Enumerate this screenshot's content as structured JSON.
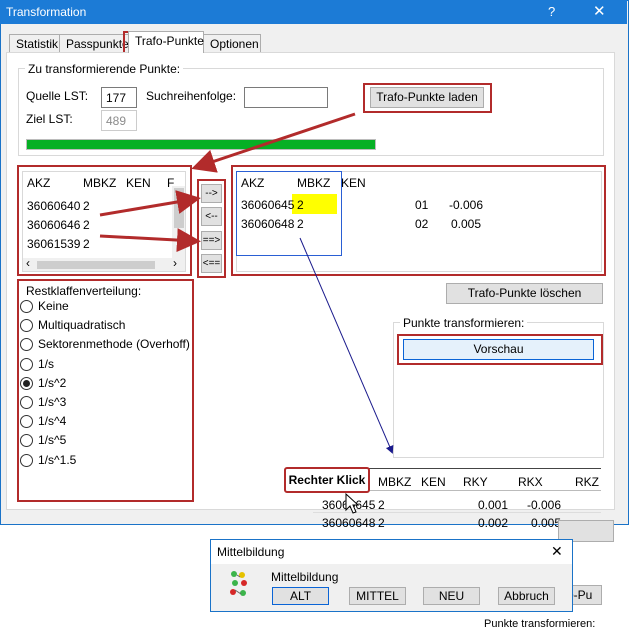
{
  "window": {
    "title": "Transformation",
    "help": "?",
    "close": "✕"
  },
  "tabs": [
    "Statistik",
    "Passpunkte",
    "Trafo-Punkte",
    "Optionen"
  ],
  "source_group": {
    "label": "Zu transformierende Punkte:",
    "quelle_label": "Quelle LST:",
    "quelle_value": "177",
    "ziel_label": "Ziel LST:",
    "ziel_value": "489",
    "suchreihenfolge_label": "Suchreihenfolge:",
    "suchreihenfolge_value": "",
    "load_button": "Trafo-Punkte laden",
    "progress_fraction": 1.0
  },
  "left_list": {
    "headers": [
      "AKZ",
      "MBKZ",
      "KEN",
      "F"
    ],
    "rows": [
      [
        "36060640",
        "2"
      ],
      [
        "36060646",
        "2"
      ],
      [
        "36061539",
        "2"
      ]
    ]
  },
  "transfer_buttons": [
    "-->",
    "<--",
    "==>",
    "<=="
  ],
  "right_list": {
    "headers": [
      "AKZ",
      "MBKZ",
      "KEN"
    ],
    "rows": [
      {
        "akz": "36060645",
        "mbkz": "2",
        "c3": "01",
        "c4": "-0.006"
      },
      {
        "akz": "36060648",
        "mbkz": "2",
        "c3": "02",
        "c4": "0.005"
      }
    ]
  },
  "delete_button": "Trafo-Punkte löschen",
  "restklaffen": {
    "label": "Restklaffenverteilung:",
    "options": [
      "Keine",
      "Multiquadratisch",
      "Sektorenmethode (Overhoff)",
      "1/s",
      "1/s^2",
      "1/s^3",
      "1/s^4",
      "1/s^5",
      "1/s^1.5"
    ],
    "selected": "1/s^2"
  },
  "transform_group": {
    "label": "Punkte transformieren:",
    "preview_button": "Vorschau"
  },
  "zoom_table": {
    "headers": [
      "MBKZ",
      "KEN",
      "RKY",
      "RKX",
      "RKZ"
    ],
    "rows": [
      {
        "akz": "36060645",
        "mbkz": "2",
        "rky": "0.001",
        "rkx": "-0.006"
      },
      {
        "akz": "36060648",
        "mbkz": "2",
        "rky": "0.002",
        "rkx": "0.005"
      }
    ]
  },
  "tooltip": "Rechter Klick",
  "dialog": {
    "title": "Mittelbildung",
    "close": "✕",
    "label": "Mittelbildung",
    "buttons": [
      "ALT",
      "MITTEL",
      "NEU",
      "Abbruch"
    ]
  },
  "behind_dialog": {
    "partial_button": "o-Pu",
    "partial_label": "Punkte transformieren:"
  },
  "colors": {
    "title_blue": "#1c7bd6",
    "progress_green": "#06b025",
    "annotation_red": "#b22b2b",
    "highlight_yellow": "#ffff00",
    "arrow_navy": "#1a1a8c"
  }
}
